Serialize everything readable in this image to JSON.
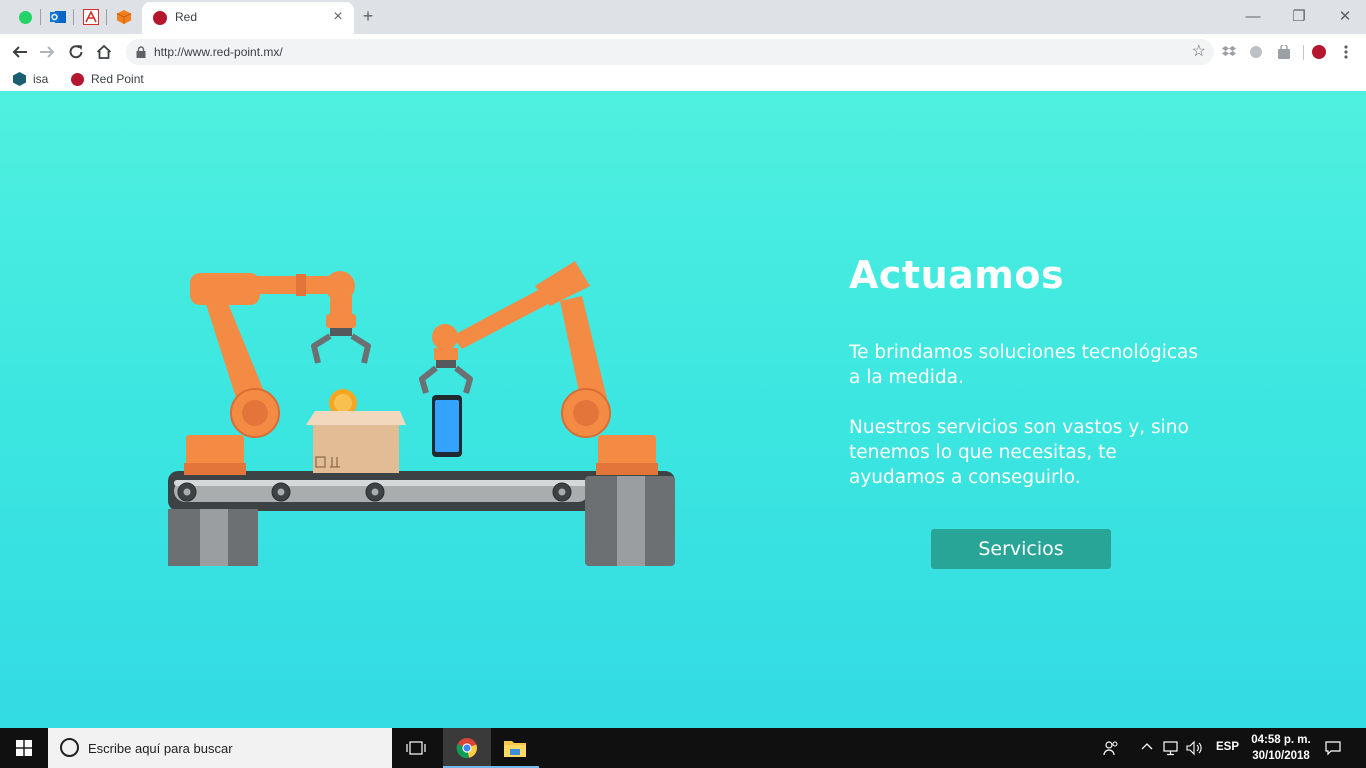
{
  "browser": {
    "tab": {
      "title": "Red",
      "close": "×"
    },
    "new_tab": "+",
    "window": {
      "minimize": "—",
      "restore": "❐",
      "close": "✕"
    },
    "url": "http://www.red-point.mx/",
    "star": "☆",
    "bookmarks": [
      {
        "label": "isa"
      },
      {
        "label": "Red Point"
      }
    ],
    "colors": {
      "favicon": "#b5172e",
      "tabstrip": "#dee1e6"
    }
  },
  "hero": {
    "title": "Actuamos",
    "paragraph_1": "Te brindamos soluciones tecnológicas a la medida.",
    "paragraph_2": "Nuestros servicios son vastos y, sino tenemos lo que necesitas, te ayudamos a conseguirlo.",
    "button": "Servicios",
    "colors": {
      "background_top": "#4ff0df",
      "background_bottom": "#33dbe2",
      "button": "#28a596"
    }
  },
  "taskbar": {
    "search_placeholder": "Escribe aquí para buscar",
    "language": "ESP",
    "time": "04:58 p. m.",
    "date": "30/10/2018"
  }
}
